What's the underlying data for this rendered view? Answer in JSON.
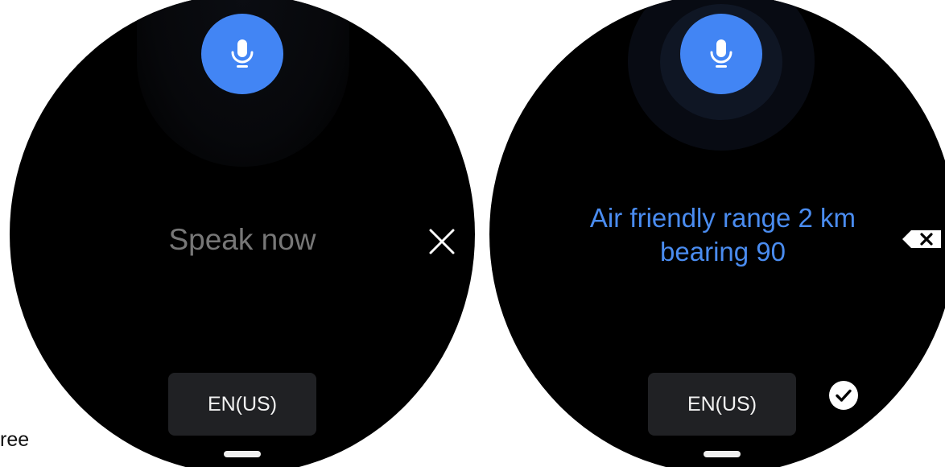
{
  "left_screen": {
    "prompt": "Speak now",
    "language_label": "EN(US)"
  },
  "right_screen": {
    "result_line1": "Air friendly range 2 km",
    "result_line2": "bearing 90",
    "language_label": "EN(US)"
  },
  "edge_fragment": "ree",
  "icons": {
    "mic": "microphone-icon",
    "close": "close-icon",
    "backspace": "backspace-icon",
    "confirm": "check-icon"
  },
  "colors": {
    "accent": "#4285f4",
    "result_text": "#4a8cf0",
    "prompt_text": "#777777",
    "button_bg": "#202124"
  }
}
